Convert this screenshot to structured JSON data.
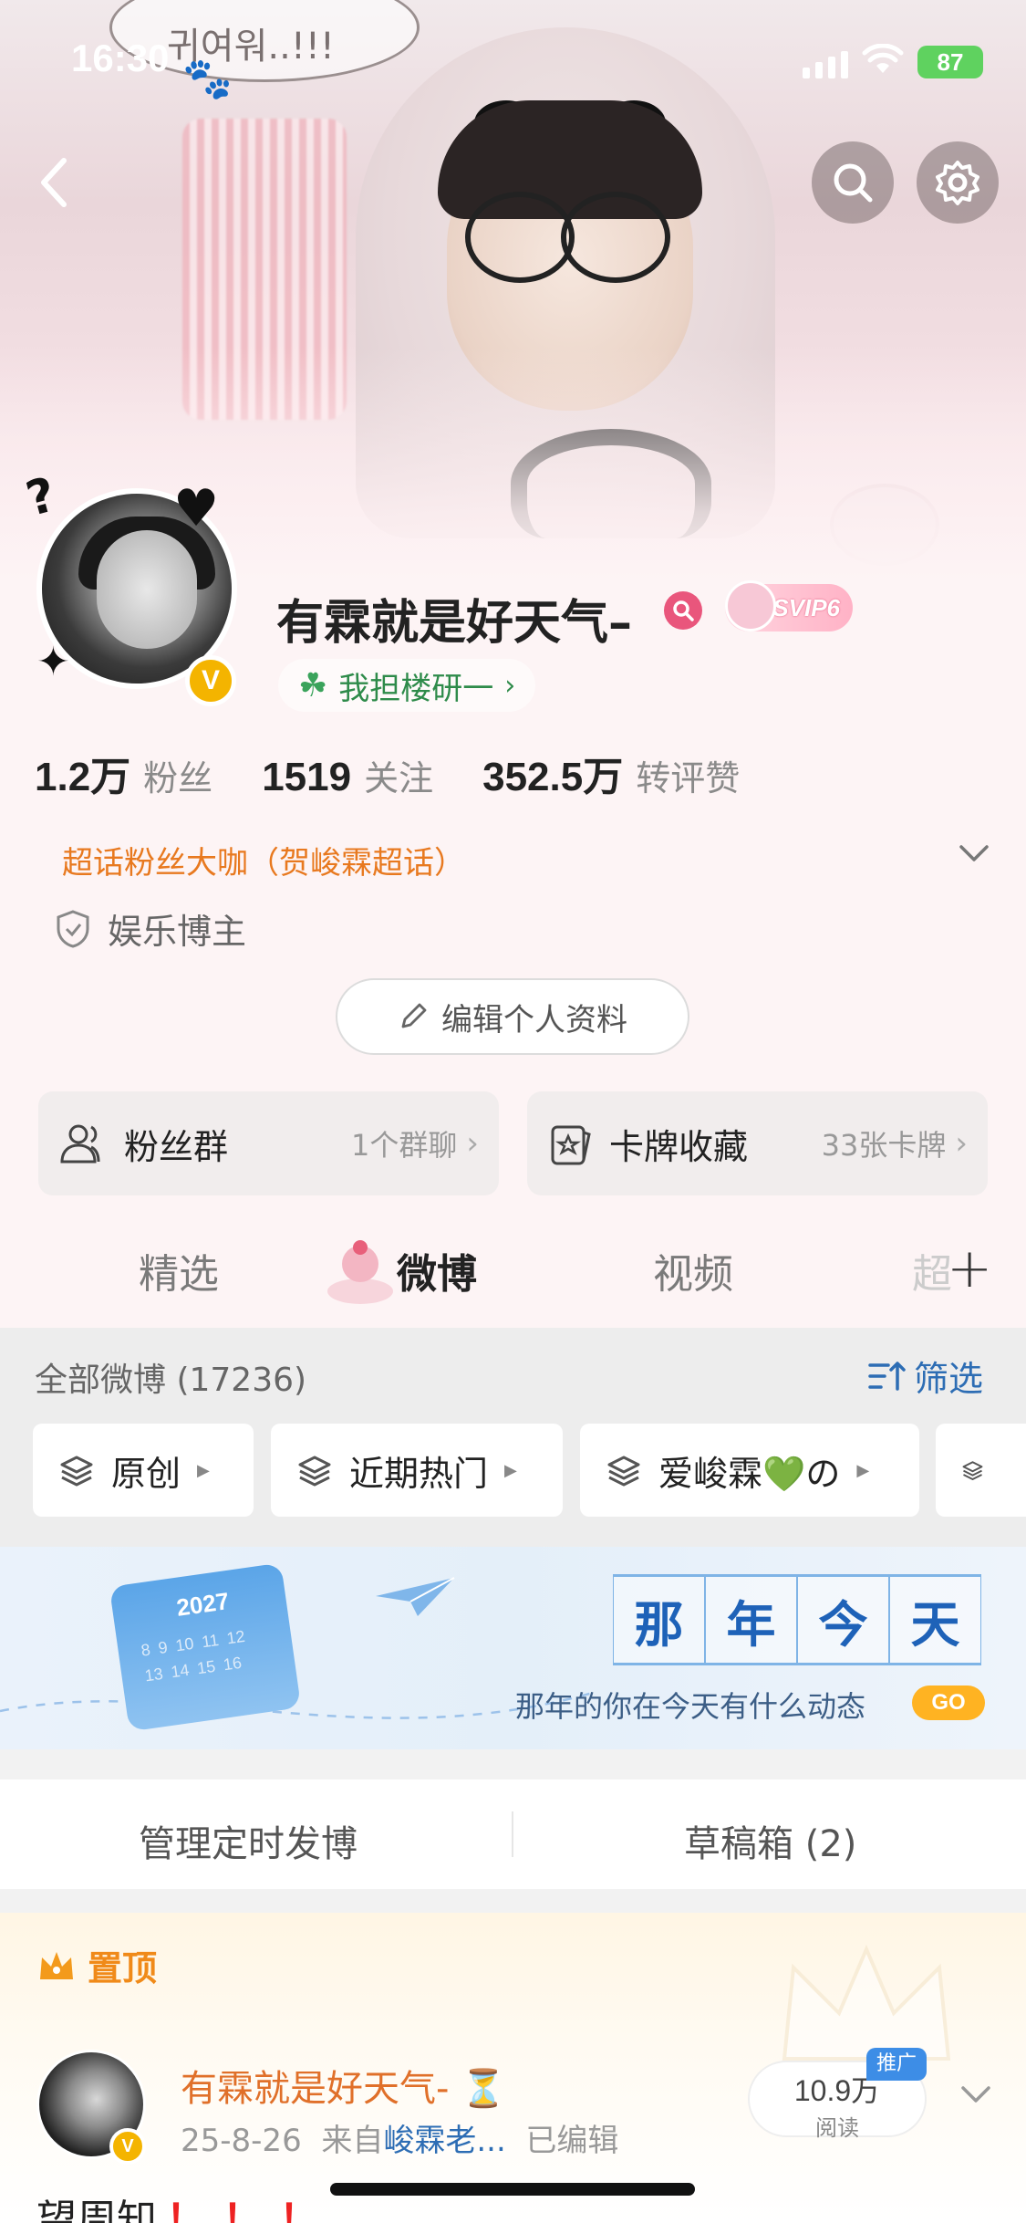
{
  "status_bar": {
    "time": "16:30",
    "battery": "87"
  },
  "banner": {
    "bubble_text": "귀여워..!!!"
  },
  "profile": {
    "username": "有霖就是好天气–",
    "vip_label": "SVIP6",
    "verified_mark": "V",
    "tag_link": "我担楼研一",
    "stats": [
      {
        "num": "1.2万",
        "label": "粉丝"
      },
      {
        "num": "1519",
        "label": "关注"
      },
      {
        "num": "352.5万",
        "label": "转评赞"
      }
    ],
    "superfan": "超话粉丝大咖（贺峻霖超话）",
    "category": "娱乐博主",
    "edit_button": "编辑个人资料"
  },
  "cards": [
    {
      "title": "粉丝群",
      "value": "1个群聊",
      "icon": "group-icon"
    },
    {
      "title": "卡牌收藏",
      "value": "33张卡牌",
      "icon": "card-icon"
    }
  ],
  "tabs": {
    "items": [
      "精选",
      "微博",
      "视频",
      "超"
    ],
    "active": "微博"
  },
  "feed": {
    "all_count": "全部微博 (17236)",
    "filter_label": "筛选",
    "chips": [
      "原创",
      "近期热门",
      "爱峻霖💚の",
      ""
    ]
  },
  "promo": {
    "year": "2027",
    "calendar_digits": "8 9 10 11 12 13 14 15 16",
    "title_chars": [
      "那",
      "年",
      "今",
      "天"
    ],
    "subtitle": "那年的你在今天有什么动态",
    "go_label": "GO"
  },
  "manage": {
    "schedule": "管理定时发博",
    "drafts": "草稿箱 (2)"
  },
  "post": {
    "pinned_label": "置顶",
    "author": "有霖就是好天气-",
    "author_emoji": "⏳",
    "date": "25-8-26",
    "source_prefix": "来自",
    "source": "峻霖老...",
    "edited": "已编辑",
    "reads_num": "10.9万",
    "reads_label": "阅读",
    "promo_badge": "推广",
    "text": "望周知",
    "exclaim": "！！！"
  },
  "colors": {
    "accent_orange": "#e8791f",
    "link_blue": "#2d6db4",
    "tag_green": "#2e8b4a",
    "go_yellow": "#ffb322"
  }
}
